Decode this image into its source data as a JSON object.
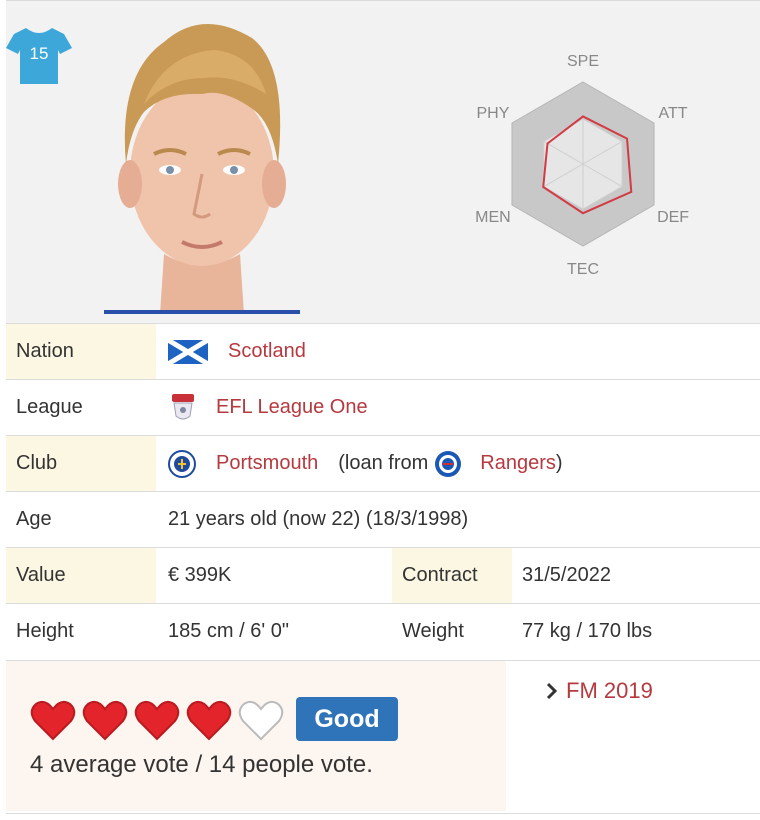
{
  "player": {
    "shirt_number": "15",
    "shirt_icon": "jersey-icon",
    "photo_icon": "player-photo"
  },
  "radar": {
    "axes": [
      "SPE",
      "ATT",
      "DEF",
      "TEC",
      "MEN",
      "PHY"
    ],
    "values": [
      0.58,
      0.62,
      0.68,
      0.6,
      0.56,
      0.5
    ],
    "colors": {
      "outer": "#c8c8c8",
      "inner": "#e6e6e6",
      "line": "#d23a44"
    }
  },
  "info": {
    "nation_label": "Nation",
    "nation_value": "Scotland",
    "nation_icon": "scotland-flag-icon",
    "league_label": "League",
    "league_value": "EFL League One",
    "league_icon": "efl-league-one-logo",
    "club_label": "Club",
    "club_value": "Portsmouth",
    "club_icon": "portsmouth-crest-icon",
    "loan_prefix": "(loan from",
    "loan_club": "Rangers",
    "loan_club_icon": "rangers-crest-icon",
    "loan_suffix": ")",
    "age_label": "Age",
    "age_value": "21 years old (now 22) (18/3/1998)",
    "value_label": "Value",
    "value_value": "€ 399K",
    "contract_label": "Contract",
    "contract_value": "31/5/2022",
    "height_label": "Height",
    "height_value": "185 cm / 6' 0\"",
    "weight_label": "Weight",
    "weight_value": "77 kg / 170 lbs"
  },
  "vote": {
    "rating": 4,
    "max": 5,
    "badge": "Good",
    "text": "4 average vote / 14 people vote."
  },
  "version_link": {
    "label": "FM 2019",
    "icon": "chevron-right-icon"
  },
  "colors": {
    "link": "#b5393f",
    "highlight": "#fbf7e3",
    "badge": "#2f73b8",
    "heart": "#e3242b",
    "shirt": "#3ea7d9"
  }
}
